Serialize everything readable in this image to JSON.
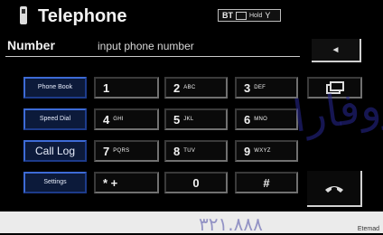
{
  "header": {
    "title": "Telephone"
  },
  "status": {
    "bt": "BT",
    "mid": "Hold",
    "signal": "Y"
  },
  "number": {
    "label": "Number",
    "placeholder": "input phone number"
  },
  "back": {
    "label": "◄"
  },
  "buttons": {
    "phonebook": "Phone Book",
    "speeddial": "Speed Dial",
    "calllog": "Call Log",
    "settings": "Settings",
    "k1": {
      "digit": "1",
      "letters": ""
    },
    "k2": {
      "digit": "2",
      "letters": "ABC"
    },
    "k3": {
      "digit": "3",
      "letters": "DEF"
    },
    "k4": {
      "digit": "4",
      "letters": "GHI"
    },
    "k5": {
      "digit": "5",
      "letters": "JKL"
    },
    "k6": {
      "digit": "6",
      "letters": "MNO"
    },
    "k7": {
      "digit": "7",
      "letters": "PQRS"
    },
    "k8": {
      "digit": "8",
      "letters": "TUV"
    },
    "k9": {
      "digit": "9",
      "letters": "WXYZ"
    },
    "kstar": {
      "digit": "* +",
      "letters": ""
    },
    "k0": {
      "digit": "0",
      "letters": ""
    },
    "khash": {
      "digit": "#",
      "letters": ""
    }
  },
  "watermark": {
    "arabic": "دروفارا",
    "number": "٣٢١.٨٨٨",
    "credit": "Etemad"
  },
  "colors": {
    "blue": "#3d6bd6",
    "bg": "#000000"
  }
}
